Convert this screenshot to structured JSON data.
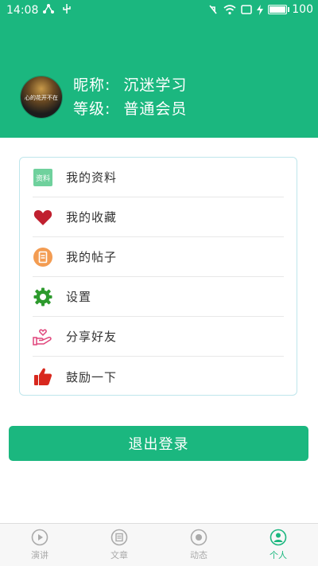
{
  "status_bar": {
    "time": "14:08",
    "battery": "100",
    "battery_level": 100
  },
  "profile": {
    "avatar_text": "心的花开不在",
    "nickname_label": "昵称:",
    "nickname": "沉迷学习",
    "level_label": "等级:",
    "level": "普通会员"
  },
  "menu": {
    "items": [
      {
        "label": "我的资料",
        "icon": "profile-card-icon",
        "icon_text": "资料"
      },
      {
        "label": "我的收藏",
        "icon": "heart-icon"
      },
      {
        "label": "我的帖子",
        "icon": "post-icon"
      },
      {
        "label": "设置",
        "icon": "gear-icon"
      },
      {
        "label": "分享好友",
        "icon": "share-hand-icon"
      },
      {
        "label": "鼓励一下",
        "icon": "thumbs-up-icon"
      }
    ]
  },
  "logout_label": "退出登录",
  "bottom_nav": {
    "items": [
      {
        "label": "演讲",
        "icon": "play-icon"
      },
      {
        "label": "文章",
        "icon": "article-icon"
      },
      {
        "label": "动态",
        "icon": "feed-icon"
      },
      {
        "label": "个人",
        "icon": "person-icon",
        "active": true
      }
    ]
  },
  "colors": {
    "brand_green": "#1bb77f",
    "card_border": "#bfe6ec",
    "heart_red": "#c0202f",
    "post_orange": "#f39c52",
    "gear_green": "#2d9a2d",
    "share_pink": "#e0457b",
    "thumb_red": "#d8281e"
  }
}
